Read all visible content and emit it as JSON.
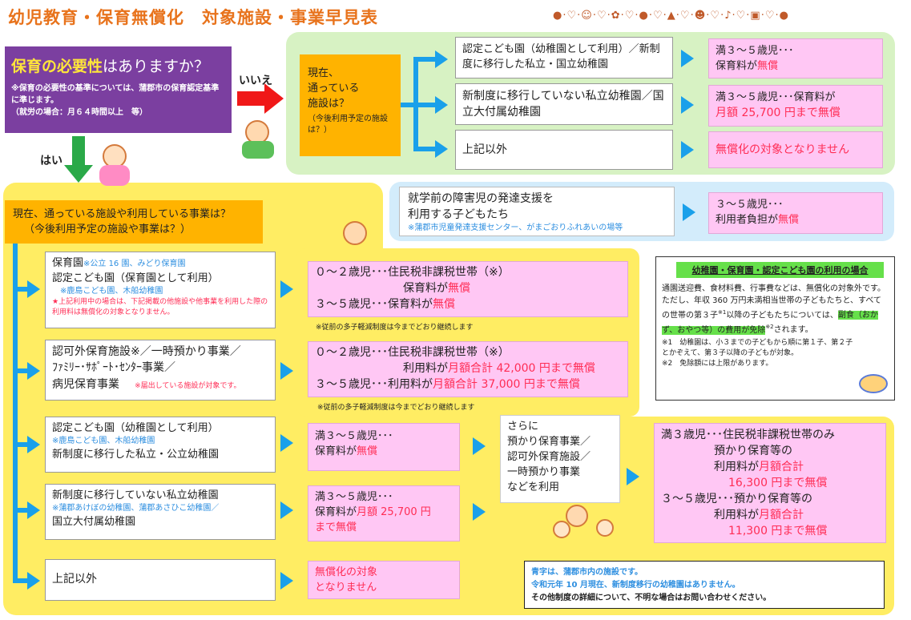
{
  "title": "幼児教育・保育無償化　対象施設・事業早見表",
  "decoration": "●·♡·☺·♡·✿·♡·●·♡·▲·♡·☻·♡·♪·♡·▣·♡·●",
  "question": {
    "main_a": "保育の必要性",
    "main_b": "はありますか？",
    "note": "※保育の必要性の基準については、蒲郡市の保育認定基準に準じます。",
    "note2": "（就労の場合：月６４時間以上　等）"
  },
  "no_label": "いいえ",
  "yes_label": "はい",
  "green": {
    "q_line1": "現在、",
    "q_line2": "通っている",
    "q_line3": "施設は？",
    "q_note": "（今後利用予定の施設は？）",
    "rows": [
      {
        "facility": "認定こども園（幼稚園として利用）／新制度に移行した私立・国立幼稚園",
        "res_a": "満３～５歳児･･･",
        "res_b": "保育料が",
        "res_c": "無償"
      },
      {
        "facility": "新制度に移行していない私立幼稚園／国立大付属幼稚園",
        "res_a": "満３～５歳児･･･保育料が",
        "res_c": "月額 25,700 円まで無償"
      },
      {
        "facility": "上記以外",
        "res_c": "無償化の対象となりません"
      }
    ]
  },
  "disability": {
    "line1": "就学前の障害児の発達支援を",
    "line2": "利用する子どもたち",
    "note": "※蒲郡市児童発達支援センター、がまごおりふれあいの場等",
    "res_a": "３～５歳児･･･",
    "res_b": "利用者負担が",
    "res_c": "無償"
  },
  "yes_q": {
    "line1": "現在、通っている施設や利用している事業は？",
    "line2": "（今後利用予定の施設や事業は？）"
  },
  "y_rows": {
    "r1": {
      "name_a": "保育園",
      "name_a_note": "※公立 16 園、みどり保育園",
      "name_b": "認定こども園（保育園として利用）",
      "note1": "※鹿島こども園、木船幼稚園",
      "note2": "★上記利用中の場合は、下記掲載の他施設や他事業を利用した際の利用料は無償化の対象となりません。",
      "res1": "０～２歳児･･･住民税非課税世帯（※）",
      "res2a": "保育料が",
      "res2b": "無償",
      "res3a": "３～５歳児･･･保育料が",
      "res3b": "無償",
      "footnote": "※従前の多子軽減制度は今までどおり継続します"
    },
    "r2": {
      "name_a": "認可外保育施設",
      "name_b": "※／一時預かり事業／",
      "name_c": "ﾌｧﾐﾘｰ･ｻﾎﾟｰﾄ･ｾﾝﾀｰ事業／",
      "name_d": "病児保育事業",
      "note": "※届出している施設が対象です。",
      "res1": "０～２歳児･･･住民税非課税世帯（※）",
      "res2a": "利用料が",
      "res2b": "月額合計 42,000 円まで無償",
      "res3a": "３～５歳児･･･利用料が",
      "res3b": "月額合計 37,000 円まで無償",
      "footnote": "※従前の多子軽減制度は今までどおり継続します"
    },
    "r3": {
      "name_a": "認定こども園（幼稚園として利用）",
      "note": "※鹿島こども園、木船幼稚園",
      "name_b": "新制度に移行した私立・公立幼稚園",
      "res_a": "満３～５歳児･･･",
      "res_b": "保育料が",
      "res_c": "無償"
    },
    "r4": {
      "name_a": "新制度に移行していない私立幼稚園",
      "note": "※蒲郡あけぼの幼稚園、蒲郡あさひこ幼稚園／",
      "name_b": "国立大付属幼稚園",
      "res_a": "満３～５歳児･･･",
      "res_b": "保育料が",
      "res_c": "月額 25,700 円",
      "res_d": "まで無償"
    },
    "r5": {
      "name": "上記以外",
      "res_a": "無償化の対象",
      "res_b": "となりません"
    }
  },
  "extra": {
    "l1": "さらに",
    "l2": "預かり保育事業／",
    "l3": "認可外保育施設／",
    "l4": "一時預かり事業",
    "l5": "などを利用"
  },
  "extra_res": {
    "a1": "満３歳児･･･住民税非課税世帯のみ",
    "a2": "預かり保育等の",
    "a3a": "利用料が",
    "a3b": "月額合計",
    "a4": "16,300 円まで無償",
    "b1": "３～５歳児･･･預かり保育等の",
    "b2a": "利用料が",
    "b2b": "月額合計",
    "b3": "11,300 円まで無償"
  },
  "note_box": {
    "title": "幼稚園・保育園・認定こども園の利用の場合",
    "p1": "通園送迎費、食材料費、行事費などは、無償化の対象外です。ただし、年収 360 万円未満相当世帯の子どもたちと、すべての世帯の第３子",
    "p1_sup": "※1",
    "p1b": "以降の子どもたちについては、",
    "p1_hl": "副食（おかず、おやつ等）の費用が免除",
    "p1_sup2": "※2",
    "p1c": "されます。",
    "n1": "※1　幼稚園は、小３までの子どもから順に第１子、第２子とかぞえて、第３子以降の子どもが対象。",
    "n2": "※2　免除額には上限があります。"
  },
  "footer": {
    "l1": "青字は、蒲郡市内の施設です。",
    "l2": "令和元年 10 月現在、新制度移行の幼稚園はありません。",
    "l3": "その他制度の詳細について、不明な場合はお問い合わせください。"
  },
  "colors": {
    "accent_blue": "#1aa0ea",
    "pink": "#ffc7f4",
    "red": "#ff2d55",
    "yellow": "#ffed63",
    "green": "#d7f2c3",
    "purple": "#7b3fa0",
    "orange": "#ffb300"
  }
}
